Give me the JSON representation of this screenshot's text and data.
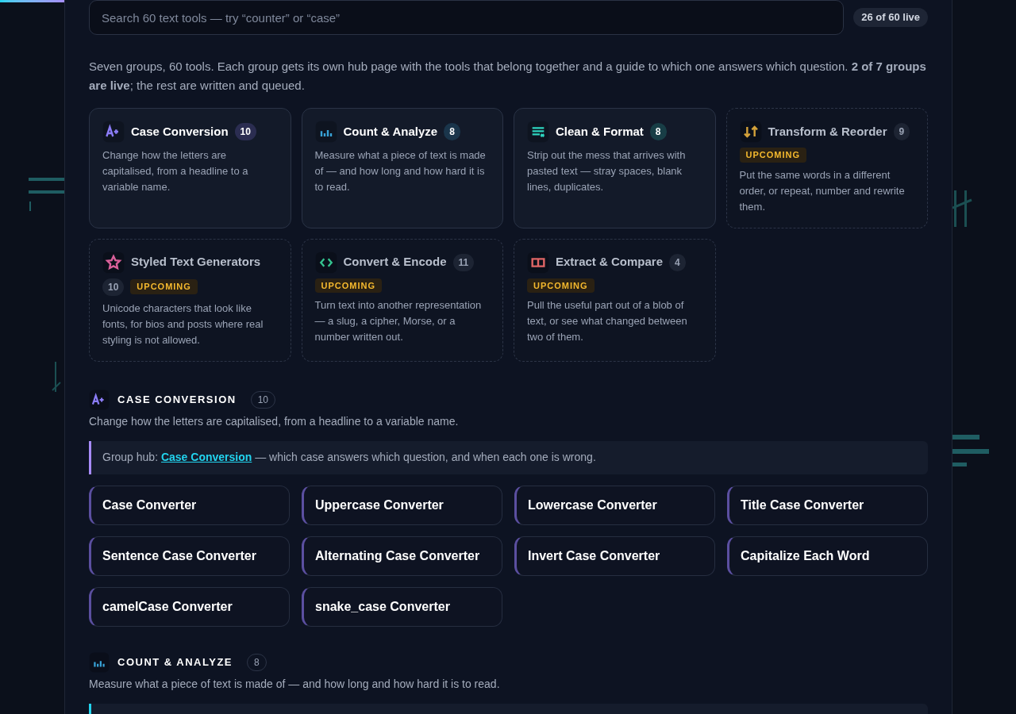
{
  "top_progress": {
    "level": 0.066
  },
  "search": {
    "placeholder": "Search 60 text tools — try “counter” or “case”"
  },
  "live_count": "26 of 60 live",
  "intro": "Seven groups, 60 tools. Each group gets its own hub page with the tools that belong together and a guide to which one answers which question. **2 of 7 groups are live**; the rest are written and queued.",
  "groups": [
    {
      "kind": "case",
      "color": "#8b7cf6",
      "name": "Case Conversion",
      "count": "10",
      "live": true,
      "description": "Change how the letters are capitalised, from a headline to a variable name."
    },
    {
      "kind": "chart",
      "color": "#38a3d8",
      "name": "Count & Analyze",
      "count": "8",
      "live": true,
      "description": "Measure what a piece of text is made of — and how long and how hard it is to read."
    },
    {
      "kind": "lines",
      "color": "#2dd4bf",
      "name": "Clean & Format",
      "count": "8",
      "live": true,
      "description": "Strip out the mess that arrives with pasted text — stray spaces, blank lines, duplicates."
    },
    {
      "kind": "arrows",
      "color": "#d4a23a",
      "name": "Transform & Reorder",
      "count": "9",
      "live": false,
      "badge": "UPCOMING",
      "description": "Put the same words in a different order, or repeat, number and rewrite them."
    },
    {
      "kind": "star",
      "color": "#d9609a",
      "name": "Styled Text Generators",
      "count": "10",
      "live": false,
      "badge": "UPCOMING",
      "description": "Unicode characters that look like fonts, for bios and posts where real styling is not allowed."
    },
    {
      "kind": "code",
      "color": "#34c38f",
      "name": "Convert & Encode",
      "count": "11",
      "live": false,
      "badge": "UPCOMING",
      "description": "Turn text into another representation — a slug, a cipher, Morse, or a number written out."
    },
    {
      "kind": "book",
      "color": "#e06666",
      "name": "Extract & Compare",
      "count": "4",
      "live": false,
      "badge": "UPCOMING",
      "description": "Pull the useful part out of a blob of text, or see what changed between two of them."
    }
  ],
  "sections": [
    {
      "kind": "case",
      "color": "#8b7cf6",
      "title": "CASE CONVERSION",
      "count": "10",
      "description": "Change how the letters are capitalised, from a headline to a variable name.",
      "hub": {
        "prefix": "Group hub: ",
        "link": "Case Conversion",
        "suffix": " — which case answers which question, and when each one is wrong."
      },
      "tools": [
        "Case Converter",
        "Uppercase Converter",
        "Lowercase Converter",
        "Title Case Converter",
        "Sentence Case Converter",
        "Alternating Case Converter",
        "Invert Case Converter",
        "Capitalize Each Word",
        "camelCase Converter",
        "snake_case Converter"
      ]
    },
    {
      "kind": "chart",
      "color": "#38a3d8",
      "title": "COUNT & ANALYZE",
      "count": "8",
      "description": "Measure what a piece of text is made of — and how long and how hard it is to read."
    }
  ]
}
